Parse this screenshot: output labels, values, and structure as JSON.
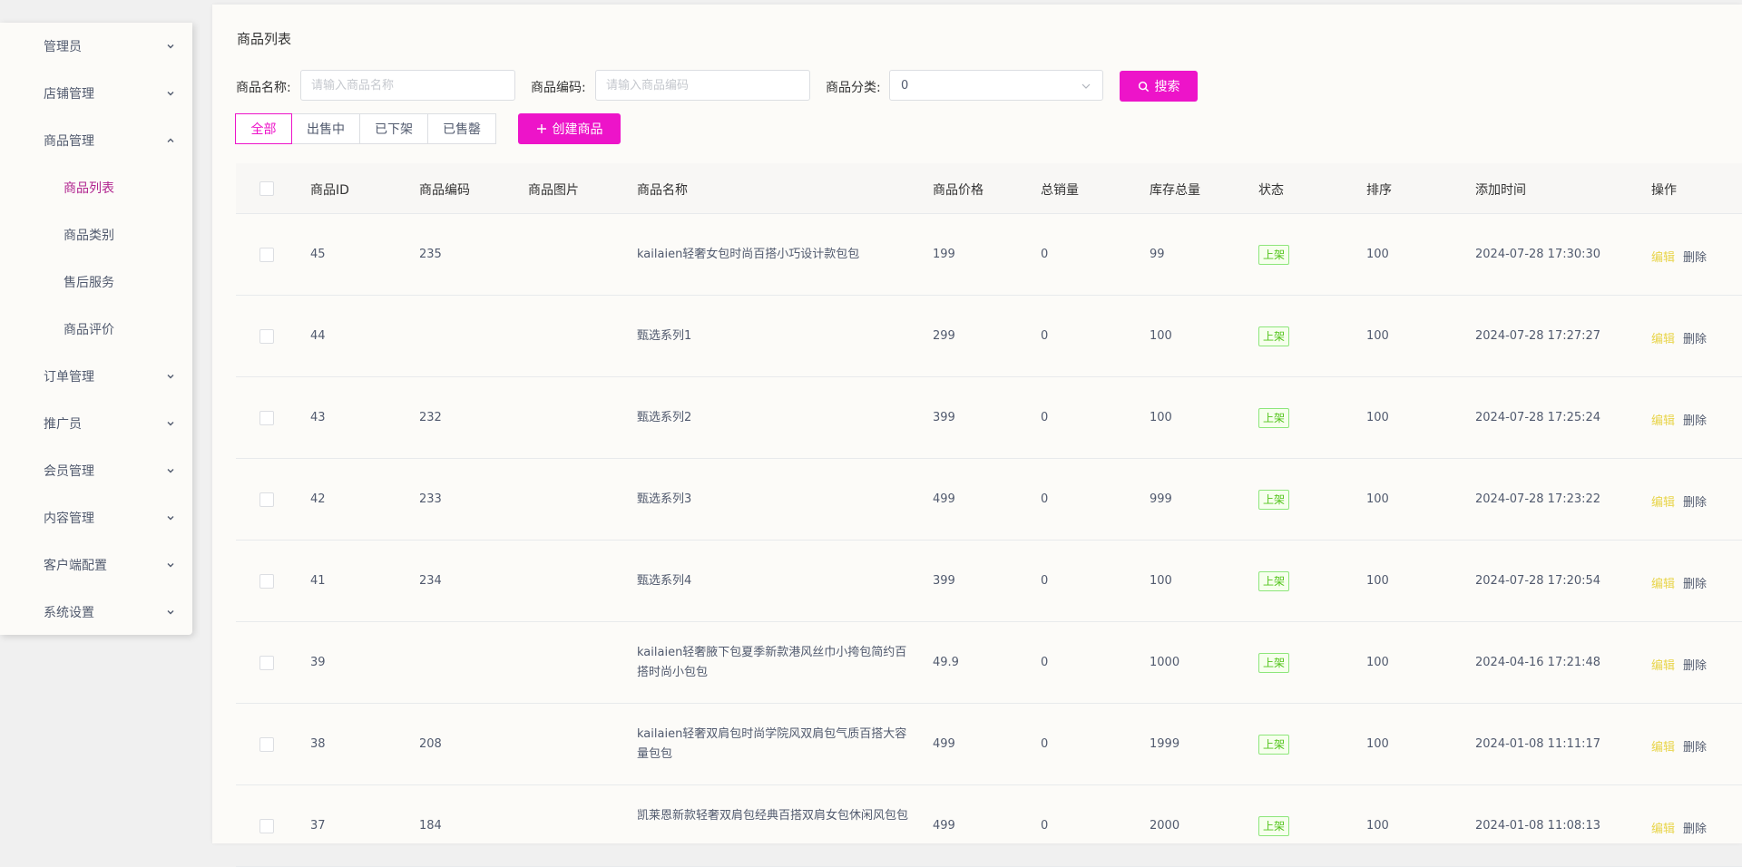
{
  "sidebar": {
    "menus": [
      {
        "label": "管理员"
      },
      {
        "label": "店铺管理"
      },
      {
        "label": "商品管理"
      },
      {
        "label": "订单管理"
      },
      {
        "label": "推广员"
      },
      {
        "label": "会员管理"
      },
      {
        "label": "内容管理"
      },
      {
        "label": "客户端配置"
      },
      {
        "label": "系统设置"
      }
    ],
    "submenus": [
      {
        "label": "商品列表",
        "active": true
      },
      {
        "label": "商品类别"
      },
      {
        "label": "售后服务"
      },
      {
        "label": "商品评价"
      }
    ]
  },
  "page": {
    "title": "商品列表"
  },
  "filters": {
    "name_label": "商品名称:",
    "name_placeholder": "请输入商品名称",
    "code_label": "商品编码:",
    "code_placeholder": "请输入商品编码",
    "category_label": "商品分类:",
    "category_value": "0",
    "search_label": "搜索"
  },
  "tabs": [
    "全部",
    "出售中",
    "已下架",
    "已售罄"
  ],
  "create_label": "创建商品",
  "table": {
    "headers": {
      "id": "商品ID",
      "code": "商品编码",
      "image": "商品图片",
      "name": "商品名称",
      "price": "商品价格",
      "sales": "总销量",
      "stock": "库存总量",
      "status": "状态",
      "sort": "排序",
      "time": "添加时间",
      "ops": "操作"
    },
    "edit_label": "编辑",
    "delete_label": "删除",
    "rows": [
      {
        "id": "45",
        "code": "235",
        "name": "kailaien轻奢女包时尚百搭小巧设计款包包",
        "price": "199",
        "sales": "0",
        "stock": "99",
        "status": "上架",
        "sort": "100",
        "time": "2024-07-28 17:30:30"
      },
      {
        "id": "44",
        "code": "",
        "name": "甄选系列1",
        "price": "299",
        "sales": "0",
        "stock": "100",
        "status": "上架",
        "sort": "100",
        "time": "2024-07-28 17:27:27"
      },
      {
        "id": "43",
        "code": "232",
        "name": "甄选系列2",
        "price": "399",
        "sales": "0",
        "stock": "100",
        "status": "上架",
        "sort": "100",
        "time": "2024-07-28 17:25:24"
      },
      {
        "id": "42",
        "code": "233",
        "name": "甄选系列3",
        "price": "499",
        "sales": "0",
        "stock": "999",
        "status": "上架",
        "sort": "100",
        "time": "2024-07-28 17:23:22"
      },
      {
        "id": "41",
        "code": "234",
        "name": "甄选系列4",
        "price": "399",
        "sales": "0",
        "stock": "100",
        "status": "上架",
        "sort": "100",
        "time": "2024-07-28 17:20:54"
      },
      {
        "id": "39",
        "code": "",
        "name": "kailaien轻奢腋下包夏季新款港风丝巾小挎包简约百搭时尚小包包",
        "price": "49.9",
        "sales": "0",
        "stock": "1000",
        "status": "上架",
        "sort": "100",
        "time": "2024-04-16 17:21:48"
      },
      {
        "id": "38",
        "code": "208",
        "name": "kailaien轻奢双肩包时尚学院风双肩包气质百搭大容量包包",
        "price": "499",
        "sales": "0",
        "stock": "1999",
        "status": "上架",
        "sort": "100",
        "time": "2024-01-08 11:11:17"
      },
      {
        "id": "37",
        "code": "184",
        "name": "凯莱恩新款轻奢双肩包经典百搭双肩女包休闲风包包",
        "price": "499",
        "sales": "0",
        "stock": "2000",
        "status": "上架",
        "sort": "100",
        "time": "2024-01-08 11:08:13"
      }
    ]
  },
  "colors": {
    "accent": "#ed14c9",
    "active_menu": "#b0248f",
    "status_green": "#52c41a",
    "edit_yellow": "#e8d44a"
  }
}
